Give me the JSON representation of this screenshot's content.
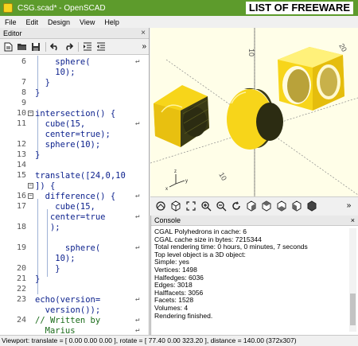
{
  "window": {
    "title": "CSG.scad* - OpenSCAD",
    "watermark": "LIST OF FREEWARE"
  },
  "menu": [
    "File",
    "Edit",
    "Design",
    "View",
    "Help"
  ],
  "editor": {
    "title": "Editor",
    "close": "×",
    "more": "»",
    "toolbar_icons": [
      "new-file-icon",
      "open-folder-icon",
      "save-icon",
      "undo-icon",
      "redo-icon",
      "indent-icon",
      "unindent-icon"
    ],
    "lines": [
      {
        "n": "6",
        "code": "    sphere(",
        "wrap": "↵"
      },
      {
        "n": "",
        "code": "    10);",
        "wrap": ""
      },
      {
        "n": "7",
        "code": "  }",
        "wrap": ""
      },
      {
        "n": "8",
        "code": "}",
        "wrap": ""
      },
      {
        "n": "9",
        "code": "",
        "wrap": ""
      },
      {
        "n": "10",
        "code": "intersection() {",
        "wrap": "",
        "fold": "−"
      },
      {
        "n": "11",
        "code": "  cube(15,",
        "wrap": "↵"
      },
      {
        "n": "",
        "code": "  center=true);",
        "wrap": ""
      },
      {
        "n": "12",
        "code": "  sphere(10);",
        "wrap": ""
      },
      {
        "n": "13",
        "code": "}",
        "wrap": ""
      },
      {
        "n": "14",
        "code": "",
        "wrap": ""
      },
      {
        "n": "15",
        "code": "translate([24,0,10",
        "wrap": ""
      },
      {
        "n": "",
        "code": "]) {",
        "wrap": "",
        "fold": "−"
      },
      {
        "n": "16",
        "code": "  difference() {",
        "wrap": "↵",
        "fold": "−"
      },
      {
        "n": "17",
        "code": "    cube(15,",
        "wrap": ""
      },
      {
        "n": "",
        "code": "   center=true",
        "wrap": "↵"
      },
      {
        "n": "18",
        "code": "   );",
        "wrap": ""
      },
      {
        "n": "",
        "code": "",
        "wrap": ""
      },
      {
        "n": "19",
        "code": "      sphere(",
        "wrap": "↵"
      },
      {
        "n": "",
        "code": "    10);",
        "wrap": ""
      },
      {
        "n": "20",
        "code": "    }",
        "wrap": ""
      },
      {
        "n": "21",
        "code": "}",
        "wrap": ""
      },
      {
        "n": "22",
        "code": "",
        "wrap": ""
      },
      {
        "n": "23",
        "code": "echo(version=",
        "wrap": "↵"
      },
      {
        "n": "",
        "code": "  version());",
        "wrap": ""
      },
      {
        "n": "24",
        "code": "// Written by",
        "wrap": "↵",
        "comment": true
      },
      {
        "n": "",
        "code": "  Marius",
        "wrap": "↵",
        "comment": true
      }
    ]
  },
  "viewport": {
    "axis_labels": [
      "10",
      "20",
      "10"
    ],
    "toolbar_icons": [
      "render-preview-icon",
      "render-icon",
      "view-all-icon",
      "zoom-in-icon",
      "zoom-out-icon",
      "reset-view-icon",
      "view-right-icon",
      "view-top-icon",
      "view-bottom-icon",
      "view-left-icon",
      "view-front-icon"
    ],
    "more": "»"
  },
  "console": {
    "title": "Console",
    "close": "×",
    "lines": [
      "CGAL Polyhedrons in cache: 6",
      "CGAL cache size in bytes: 7215344",
      "Total rendering time: 0 hours, 0 minutes, 7 seconds",
      "Top level object is a 3D object:",
      "Simple: yes",
      "Vertices: 1498",
      "Halfedges: 6036",
      "Edges: 3018",
      "Halffacets: 3056",
      "Facets: 1528",
      "Volumes: 4",
      "Rendering finished."
    ]
  },
  "status": {
    "text": "Viewport: translate = [ 0.00 0.00 0.00 ], rotate = [ 77.40 0.00 323.20 ], distance = 140.00 (372x307)"
  },
  "colors": {
    "titlebar": "#5d9b2c",
    "object_yellow": "#f7d51a",
    "object_dark": "#3a3a16",
    "code_blue": "#0a1f8c"
  }
}
